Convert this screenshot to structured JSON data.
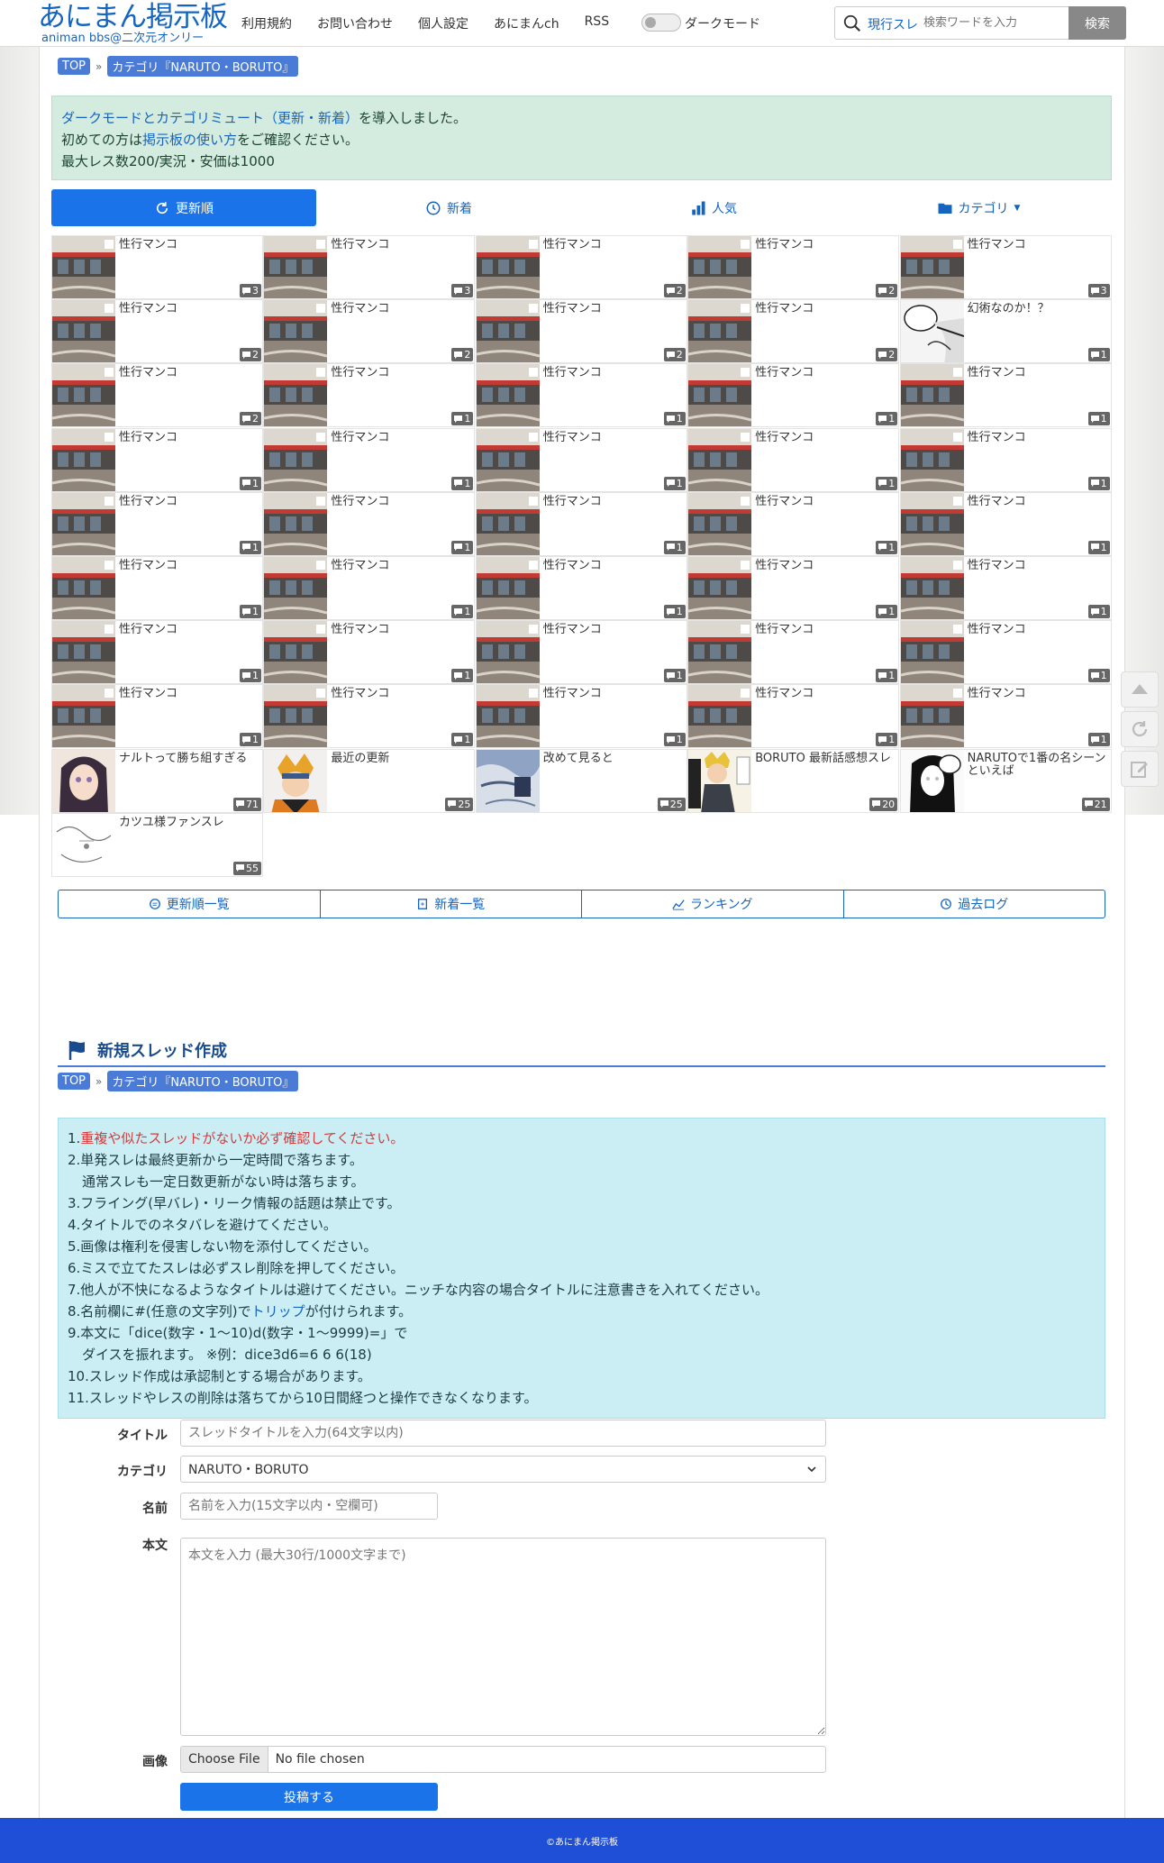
{
  "header": {
    "logo_main": "あにまん掲示板",
    "logo_sub": "animan bbs@二次元オンリー",
    "nav": [
      "利用規約",
      "お問い合わせ",
      "個人設定",
      "あにまんch",
      "RSS"
    ],
    "dark_mode_label": "ダークモード",
    "search_scope": "現行スレ",
    "search_placeholder": "検索ワードを入力",
    "search_button": "検索"
  },
  "breadcrumb": {
    "top": "TOP",
    "sep": "»",
    "category": "カテゴリ『NARUTO・BORUTO』"
  },
  "notice": {
    "line1_link": "ダークモードとカテゴリミュート（更新・新着）",
    "line1_rest": "を導入しました。",
    "line2_pre": "初めての方は",
    "line2_link": "掲示板の使い方",
    "line2_rest": "をご確認ください。",
    "line3": "最大レス数200/実況・安価は1000"
  },
  "tabs": {
    "update": "更新順",
    "new": "新着",
    "popular": "人気",
    "category": "カテゴリ"
  },
  "threads": [
    {
      "title": "性行マンコ",
      "count": "3",
      "thumb": "store"
    },
    {
      "title": "性行マンコ",
      "count": "3",
      "thumb": "store"
    },
    {
      "title": "性行マンコ",
      "count": "2",
      "thumb": "store"
    },
    {
      "title": "性行マンコ",
      "count": "2",
      "thumb": "store"
    },
    {
      "title": "性行マンコ",
      "count": "3",
      "thumb": "store"
    },
    {
      "title": "性行マンコ",
      "count": "2",
      "thumb": "store"
    },
    {
      "title": "性行マンコ",
      "count": "2",
      "thumb": "store"
    },
    {
      "title": "性行マンコ",
      "count": "2",
      "thumb": "store"
    },
    {
      "title": "性行マンコ",
      "count": "2",
      "thumb": "store"
    },
    {
      "title": "幻術なのか！？",
      "count": "1",
      "thumb": "manga"
    },
    {
      "title": "性行マンコ",
      "count": "2",
      "thumb": "store"
    },
    {
      "title": "性行マンコ",
      "count": "1",
      "thumb": "store"
    },
    {
      "title": "性行マンコ",
      "count": "1",
      "thumb": "store"
    },
    {
      "title": "性行マンコ",
      "count": "1",
      "thumb": "store"
    },
    {
      "title": "性行マンコ",
      "count": "1",
      "thumb": "store"
    },
    {
      "title": "性行マンコ",
      "count": "1",
      "thumb": "store"
    },
    {
      "title": "性行マンコ",
      "count": "1",
      "thumb": "store"
    },
    {
      "title": "性行マンコ",
      "count": "1",
      "thumb": "store"
    },
    {
      "title": "性行マンコ",
      "count": "1",
      "thumb": "store"
    },
    {
      "title": "性行マンコ",
      "count": "1",
      "thumb": "store"
    },
    {
      "title": "性行マンコ",
      "count": "1",
      "thumb": "store"
    },
    {
      "title": "性行マンコ",
      "count": "1",
      "thumb": "store"
    },
    {
      "title": "性行マンコ",
      "count": "1",
      "thumb": "store"
    },
    {
      "title": "性行マンコ",
      "count": "1",
      "thumb": "store"
    },
    {
      "title": "性行マンコ",
      "count": "1",
      "thumb": "store"
    },
    {
      "title": "性行マンコ",
      "count": "1",
      "thumb": "store"
    },
    {
      "title": "性行マンコ",
      "count": "1",
      "thumb": "store"
    },
    {
      "title": "性行マンコ",
      "count": "1",
      "thumb": "store"
    },
    {
      "title": "性行マンコ",
      "count": "1",
      "thumb": "store"
    },
    {
      "title": "性行マンコ",
      "count": "1",
      "thumb": "store"
    },
    {
      "title": "性行マンコ",
      "count": "1",
      "thumb": "store"
    },
    {
      "title": "性行マンコ",
      "count": "1",
      "thumb": "store"
    },
    {
      "title": "性行マンコ",
      "count": "1",
      "thumb": "store"
    },
    {
      "title": "性行マンコ",
      "count": "1",
      "thumb": "store"
    },
    {
      "title": "性行マンコ",
      "count": "1",
      "thumb": "store"
    },
    {
      "title": "性行マンコ",
      "count": "1",
      "thumb": "store"
    },
    {
      "title": "性行マンコ",
      "count": "1",
      "thumb": "store"
    },
    {
      "title": "性行マンコ",
      "count": "1",
      "thumb": "store"
    },
    {
      "title": "性行マンコ",
      "count": "1",
      "thumb": "store"
    },
    {
      "title": "性行マンコ",
      "count": "1",
      "thumb": "store"
    },
    {
      "title": "ナルトって勝ち組すぎる",
      "count": "71",
      "thumb": "girl"
    },
    {
      "title": "最近の更新",
      "count": "25",
      "thumb": "naruto"
    },
    {
      "title": "改めて見ると",
      "count": "25",
      "thumb": "cloth"
    },
    {
      "title": "BORUTO 最新話感想スレ",
      "count": "20",
      "thumb": "boruto"
    },
    {
      "title": "NARUTOで1番の名シーンといえば",
      "count": "21",
      "thumb": "hinata"
    },
    {
      "title": "カツユ様ファンスレ",
      "count": "55",
      "thumb": "sketch"
    }
  ],
  "links": {
    "update_list": "更新順一覧",
    "new_list": "新着一覧",
    "ranking": "ランキング",
    "archive": "過去ログ"
  },
  "new_thread": {
    "heading": "新規スレッド作成"
  },
  "rules": {
    "r1_num": "1.",
    "r1": "重複や似たスレッドがないか必ず確認してください。",
    "r2": "2.単発スレは最終更新から一定時間で落ちます。",
    "r2b": "通常スレも一定日数更新がない時は落ちます。",
    "r3": "3.フライング(早バレ)・リーク情報の話題は禁止です。",
    "r4": "4.タイトルでのネタバレを避けてください。",
    "r5": "5.画像は権利を侵害しない物を添付してください。",
    "r6": "6.ミスで立てたスレは必ずスレ削除を押してください。",
    "r7": "7.他人が不快になるようなタイトルは避けてください。ニッチな内容の場合タイトルに注意書きを入れてください。",
    "r8_pre": "8.名前欄に#(任意の文字列)で",
    "r8_link": "トリップ",
    "r8_post": "が付けられます。",
    "r9": "9.本文に「dice(数字・1〜10)d(数字・1〜9999)=」で",
    "r9b": "ダイスを振れます。 ※例：dice3d6=6 6 6(18)",
    "r10": "10.スレッド作成は承認制とする場合があります。",
    "r11": "11.スレッドやレスの削除は落ちてから10日間経つと操作できなくなります。"
  },
  "form": {
    "title_label": "タイトル",
    "title_placeholder": "スレッドタイトルを入力(64文字以内)",
    "category_label": "カテゴリ",
    "category_value": "NARUTO・BORUTO",
    "name_label": "名前",
    "name_placeholder": "名前を入力(15文字以内・空欄可)",
    "body_label": "本文",
    "body_placeholder": "本文を入力 (最大30行/1000文字まで)",
    "image_label": "画像",
    "file_button": "Choose File",
    "file_status": "No file chosen",
    "submit": "投稿する"
  },
  "footer": {
    "copyright": "©あにまん掲示板"
  },
  "colors": {
    "brand": "#1565c0",
    "primary": "#1a73e8",
    "footer": "#1f4fd6"
  }
}
